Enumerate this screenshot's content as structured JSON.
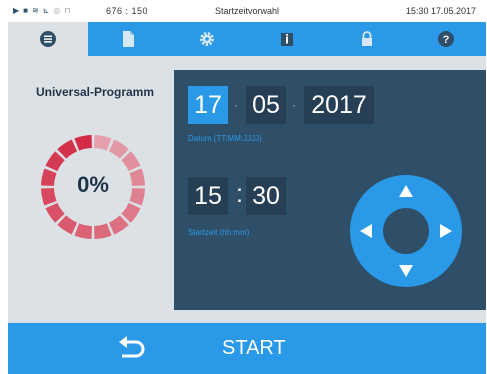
{
  "status": {
    "icons": [
      "play-icon",
      "file-icon",
      "steam-icon",
      "chart-icon",
      "record-icon",
      "lock-icon"
    ],
    "counter": "676 : 150",
    "title": "Startzeitvorwahl",
    "time": "15:30  17.05.2017"
  },
  "tabs": [
    {
      "icon": "list-icon",
      "active": true
    },
    {
      "icon": "document-icon",
      "active": false
    },
    {
      "icon": "gear-icon",
      "active": false
    },
    {
      "icon": "info-icon",
      "active": false
    },
    {
      "icon": "lock-icon",
      "active": false
    },
    {
      "icon": "help-icon",
      "active": false
    }
  ],
  "program": {
    "title": "Universal-Programm",
    "progress_label": "0%",
    "progress": 0
  },
  "date": {
    "day": "17",
    "month": "05",
    "year": "2017",
    "hint": "Datum (TT:MM:JJJJ)",
    "selected_field": "day"
  },
  "time": {
    "hour": "15",
    "minute": "30",
    "colon": ":",
    "hint": "Startzeit (hh:mm)"
  },
  "bottom": {
    "start_label": "START"
  },
  "colors": {
    "accent": "#2a9ae8",
    "panel": "#2f4e67",
    "field": "#263f54",
    "ring_dark": "#d32a45",
    "ring_light": "#e4a0ac"
  }
}
